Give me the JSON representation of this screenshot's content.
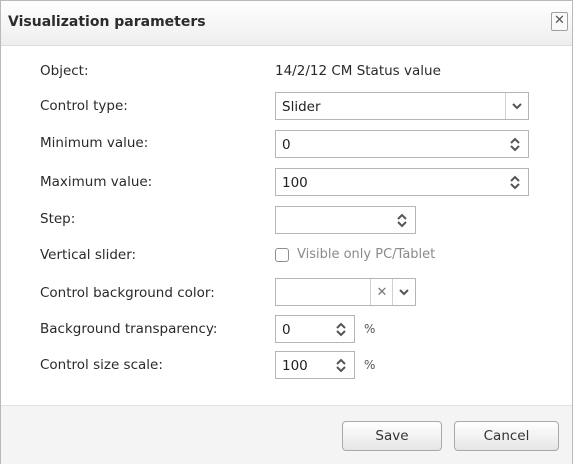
{
  "dialog": {
    "title": "Visualization parameters",
    "close_glyph": "✕"
  },
  "form": {
    "object": {
      "label": "Object:",
      "value": "14/2/12 CM Status value"
    },
    "control_type": {
      "label": "Control type:",
      "value": "Slider"
    },
    "minimum": {
      "label": "Minimum value:",
      "value": "0"
    },
    "maximum": {
      "label": "Maximum value:",
      "value": "100"
    },
    "step": {
      "label": "Step:",
      "value": ""
    },
    "vertical_slider": {
      "label": "Vertical slider:",
      "checkbox_label": "Visible only PC/Tablet",
      "checked": false
    },
    "bg_color": {
      "label": "Control background color:",
      "value": "",
      "clear_glyph": "✕"
    },
    "bg_transparency": {
      "label": "Background transparency:",
      "value": "0",
      "unit": "%"
    },
    "size_scale": {
      "label": "Control size scale:",
      "value": "100",
      "unit": "%"
    }
  },
  "buttons": {
    "save": "Save",
    "cancel": "Cancel"
  },
  "icons": {
    "close": "close-icon",
    "dropdown": "chevron-down-icon",
    "spin_up": "chevron-up-icon",
    "spin_down": "chevron-down-icon",
    "clear": "clear-icon"
  }
}
